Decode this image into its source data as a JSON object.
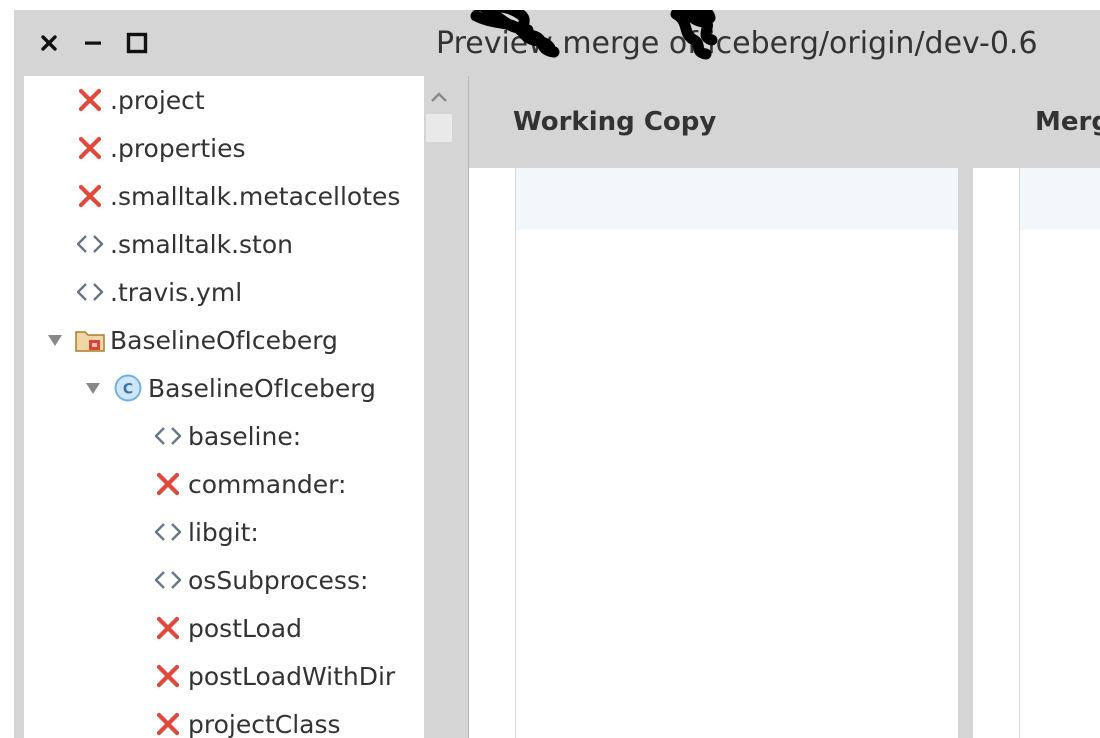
{
  "window": {
    "controls": {
      "close": "×",
      "minimize": "–",
      "maximize": "□"
    },
    "title": "Preview merge of iceberg/origin/dev-0.6"
  },
  "tree": {
    "items": [
      {
        "label": ".project",
        "icon": "removed-icon",
        "depth": 0,
        "expander": "none"
      },
      {
        "label": ".properties",
        "icon": "removed-icon",
        "depth": 0,
        "expander": "none"
      },
      {
        "label": ".smalltalk.metacellotes",
        "icon": "removed-icon",
        "depth": 0,
        "expander": "none"
      },
      {
        "label": ".smalltalk.ston",
        "icon": "modified-icon",
        "depth": 0,
        "expander": "none"
      },
      {
        "label": ".travis.yml",
        "icon": "modified-icon",
        "depth": 0,
        "expander": "none"
      },
      {
        "label": "BaselineOfIceberg",
        "icon": "package-folder-icon",
        "depth": 0,
        "expander": "expanded"
      },
      {
        "label": "BaselineOfIceberg",
        "icon": "class-icon",
        "depth": 1,
        "expander": "expanded"
      },
      {
        "label": "baseline:",
        "icon": "modified-icon",
        "depth": 2,
        "expander": "none"
      },
      {
        "label": "commander:",
        "icon": "removed-icon",
        "depth": 2,
        "expander": "none"
      },
      {
        "label": "libgit:",
        "icon": "modified-icon",
        "depth": 2,
        "expander": "none"
      },
      {
        "label": "osSubprocess:",
        "icon": "modified-icon",
        "depth": 2,
        "expander": "none"
      },
      {
        "label": "postLoad",
        "icon": "removed-icon",
        "depth": 2,
        "expander": "none"
      },
      {
        "label": "postLoadWithDir",
        "icon": "removed-icon",
        "depth": 2,
        "expander": "none"
      },
      {
        "label": "projectClass",
        "icon": "removed-icon",
        "depth": 2,
        "expander": "none"
      }
    ]
  },
  "diff": {
    "left_header": "Working Copy",
    "right_header": "Merg"
  },
  "colors": {
    "removed": "#e0493b",
    "modified": "#6a7686",
    "class_badge": "#6fb3e6",
    "folder": "#d29a3c"
  }
}
